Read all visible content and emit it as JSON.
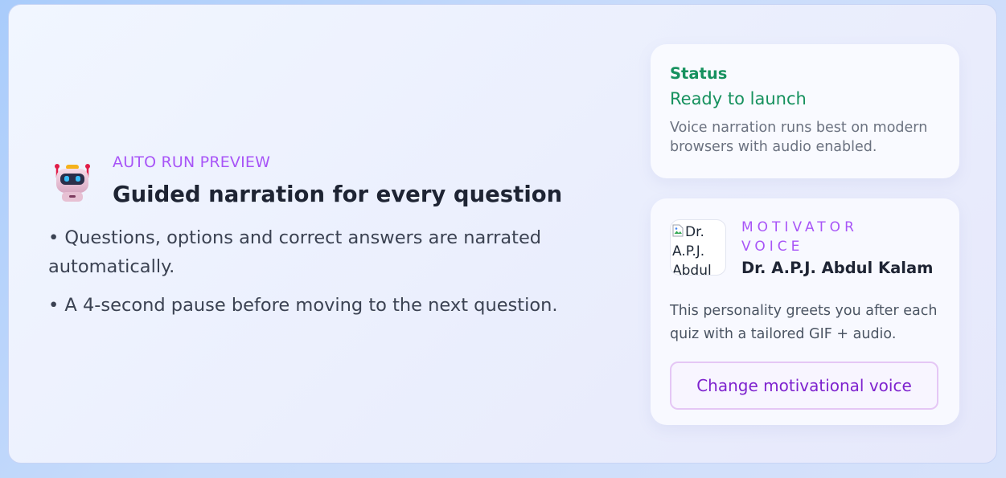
{
  "hero": {
    "icon": "robot-icon",
    "eyebrow": "AUTO RUN PREVIEW",
    "title": "Guided narration for every question",
    "bullets": [
      "• Questions, options and correct answers are narrated automatically.",
      "• A 4-second pause before moving to the next question."
    ]
  },
  "status": {
    "label": "Status",
    "value": "Ready to launch",
    "note": "Voice narration runs best on modern browsers with audio enabled.",
    "color": "#16915e"
  },
  "voice": {
    "eyebrow": "MOTIVATOR VOICE",
    "name": "Dr. A.P.J. Abdul Kalam",
    "avatar_alt": "Dr. A.P.J. Abdul Kalam",
    "description": "This personality greets you after each quiz with a tailored GIF + audio.",
    "button_label": "Change motivational voice",
    "accent": "#a855f7"
  }
}
